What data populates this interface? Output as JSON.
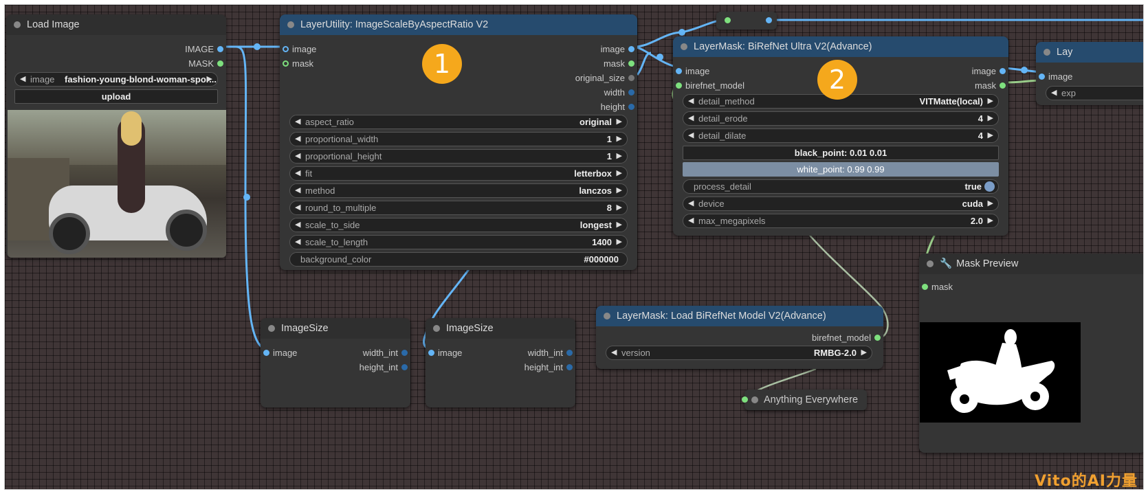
{
  "nodes": {
    "load_image": {
      "title": "Load Image",
      "outputs": [
        "IMAGE",
        "MASK"
      ],
      "image_label": "image",
      "image_value": "fashion-young-blond-woman-spor...",
      "upload_label": "upload"
    },
    "scale_by_ratio": {
      "title": "LayerUtility: ImageScaleByAspectRatio V2",
      "inputs": [
        "image",
        "mask"
      ],
      "outputs": [
        "image",
        "mask",
        "original_size",
        "width",
        "height"
      ],
      "widgets": [
        {
          "name": "aspect_ratio",
          "value": "original"
        },
        {
          "name": "proportional_width",
          "value": "1"
        },
        {
          "name": "proportional_height",
          "value": "1"
        },
        {
          "name": "fit",
          "value": "letterbox"
        },
        {
          "name": "method",
          "value": "lanczos"
        },
        {
          "name": "round_to_multiple",
          "value": "8"
        },
        {
          "name": "scale_to_side",
          "value": "longest"
        },
        {
          "name": "scale_to_length",
          "value": "1400"
        },
        {
          "name": "background_color",
          "value": "#000000"
        }
      ]
    },
    "birefnet_ultra": {
      "title": "LayerMask: BiRefNet Ultra V2(Advance)",
      "inputs": [
        "image",
        "birefnet_model"
      ],
      "outputs": [
        "image",
        "mask"
      ],
      "detail_method": {
        "name": "detail_method",
        "value": "VITMatte(local)"
      },
      "detail_erode": {
        "name": "detail_erode",
        "value": "4"
      },
      "detail_dilate": {
        "name": "detail_dilate",
        "value": "4"
      },
      "black_point": "black_point: 0.01  0.01",
      "white_point": "white_point: 0.99  0.99",
      "process_detail": {
        "name": "process_detail",
        "value": "true"
      },
      "device": {
        "name": "device",
        "value": "cuda"
      },
      "max_megapixels": {
        "name": "max_megapixels",
        "value": "2.0"
      }
    },
    "image_size_1": {
      "title": "ImageSize",
      "input": "image",
      "outputs": [
        "width_int",
        "height_int"
      ]
    },
    "image_size_2": {
      "title": "ImageSize",
      "input": "image",
      "outputs": [
        "width_int",
        "height_int"
      ]
    },
    "load_birefnet": {
      "title": "LayerMask: Load BiRefNet Model V2(Advance)",
      "output": "birefnet_model",
      "version": {
        "name": "version",
        "value": "RMBG-2.0"
      }
    },
    "anything_everywhere": {
      "title": "Anything Everywhere"
    },
    "mask_preview": {
      "title": "Mask Preview",
      "input": "mask"
    },
    "partial_right": {
      "title": "Lay",
      "input": "image",
      "widget": "exp"
    }
  },
  "badges": [
    "1",
    "2"
  ],
  "watermark": "Vito的AI力量",
  "colors": {
    "canvas": "#3f3536",
    "node": "#353535",
    "title_blue": "#264b6e",
    "wire_image": "#64b5f6",
    "wire_mask": "#9acd8a",
    "badge": "#f5a81c"
  }
}
